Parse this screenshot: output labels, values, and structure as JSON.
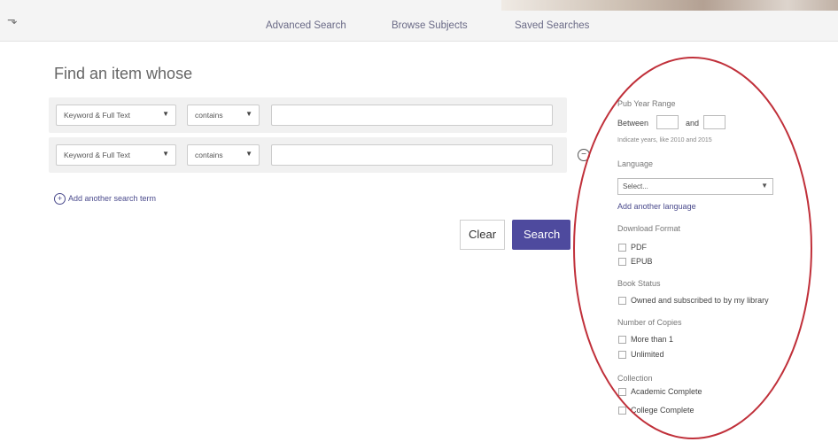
{
  "nav": {
    "links": [
      "Advanced Search",
      "Browse Subjects",
      "Saved Searches"
    ]
  },
  "page": {
    "title": "Find an item whose"
  },
  "search_rows": [
    {
      "field": "Keyword & Full Text",
      "operator": "contains",
      "value": ""
    },
    {
      "field": "Keyword & Full Text",
      "operator": "contains",
      "value": ""
    }
  ],
  "actions": {
    "add_term": "Add another search term",
    "clear": "Clear",
    "search": "Search"
  },
  "filters": {
    "pub_year": {
      "heading": "Pub Year Range",
      "between": "Between",
      "and": "and",
      "hint": "Indicate years, like 2010 and 2015"
    },
    "language": {
      "heading": "Language",
      "placeholder": "Select...",
      "add": "Add another language"
    },
    "download_format": {
      "heading": "Download Format",
      "options": [
        "PDF",
        "EPUB"
      ]
    },
    "book_status": {
      "heading": "Book Status",
      "options": [
        "Owned and subscribed to by my library"
      ]
    },
    "copies": {
      "heading": "Number of Copies",
      "options": [
        "More than 1",
        "Unlimited"
      ]
    },
    "collection": {
      "heading": "Collection",
      "options": [
        "Academic Complete",
        "College Complete"
      ]
    }
  },
  "colors": {
    "accent": "#4e4a9e",
    "annotation": "#c0303a"
  }
}
